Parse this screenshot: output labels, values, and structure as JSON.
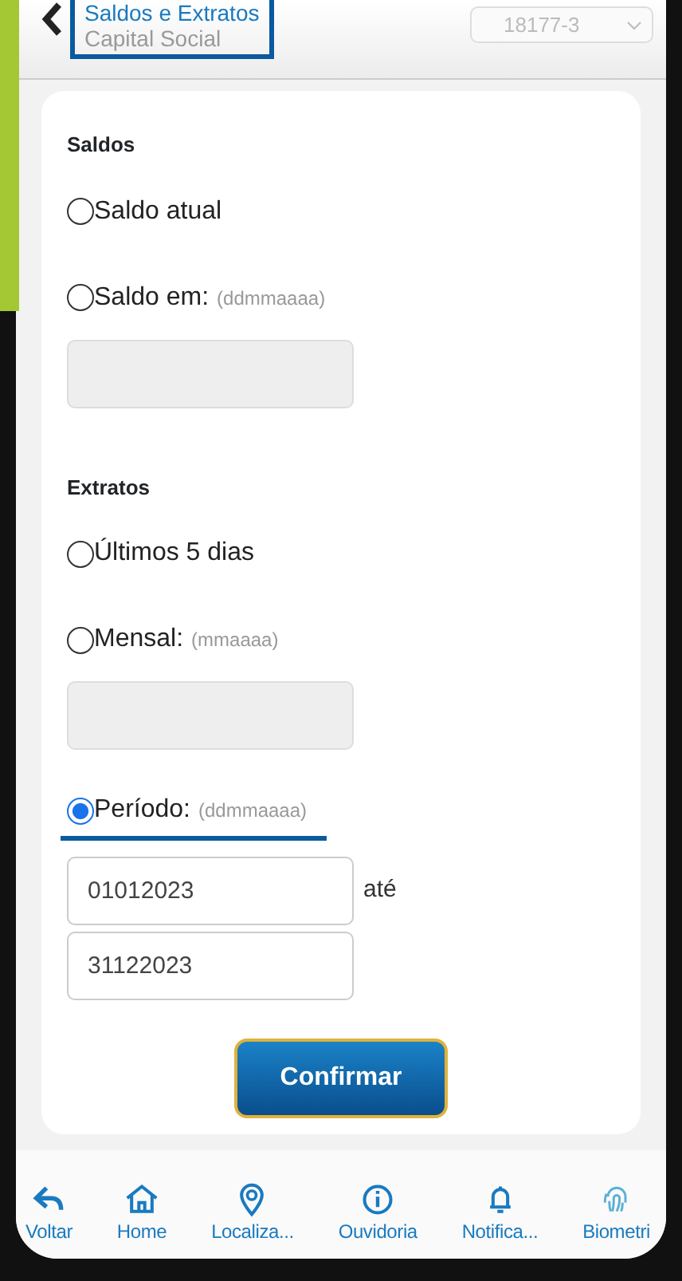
{
  "header": {
    "title": "Saldos e Extratos",
    "subtitle": "Capital Social",
    "account": "18177-3"
  },
  "sections": [
    {
      "heading": "Saldos",
      "options": [
        {
          "kind": "plain",
          "label": "Saldo atual",
          "selected": false
        },
        {
          "kind": "date",
          "label": "Saldo em:",
          "hint": "(ddmmaaaa)",
          "selected": false
        }
      ]
    },
    {
      "heading": "Extratos",
      "options": [
        {
          "kind": "plain",
          "label": "Últimos 5 dias",
          "selected": false
        },
        {
          "kind": "date",
          "label": "Mensal:",
          "hint": "(mmaaaa)",
          "selected": false
        },
        {
          "kind": "range",
          "label": "Período:",
          "hint": "(ddmmaaaa)",
          "selected": true,
          "from": "01012023",
          "separator": "até",
          "to": "31122023"
        }
      ]
    }
  ],
  "confirm_button": "Confirmar",
  "nav": [
    {
      "kind": "back",
      "label": "Voltar"
    },
    {
      "kind": "home",
      "label": "Home"
    },
    {
      "kind": "pin",
      "label": "Localiza..."
    },
    {
      "kind": "info",
      "label": "Ouvidoria"
    },
    {
      "kind": "bell",
      "label": "Notifica..."
    },
    {
      "kind": "fingerprint",
      "label": "Biometri"
    }
  ]
}
